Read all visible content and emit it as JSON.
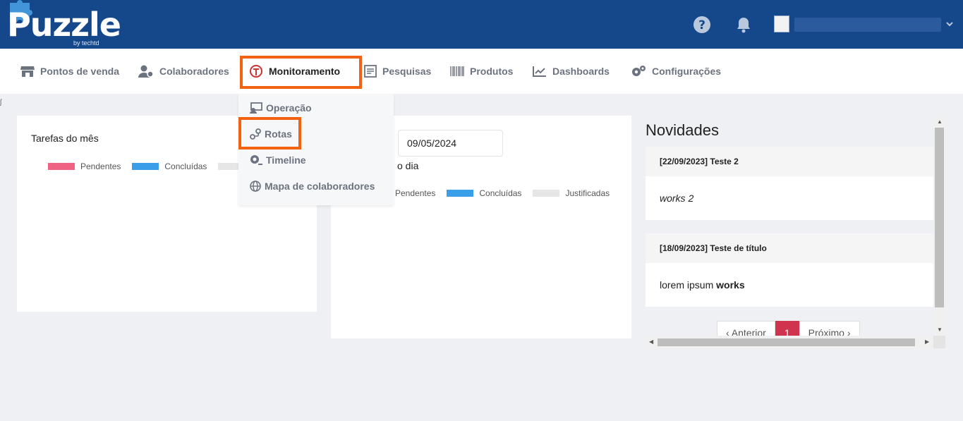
{
  "header": {
    "logo_text": "Puzzle",
    "logo_sub": "by techtd",
    "icons": [
      "help-icon",
      "bell-icon",
      "avatar",
      "chevron-down-icon"
    ],
    "brand_color": "#15478b"
  },
  "nav": {
    "items": [
      {
        "label": "Pontos de venda",
        "icon": "store-icon"
      },
      {
        "label": "Colaboradores",
        "icon": "user-gear-icon"
      },
      {
        "label": "Monitoramento",
        "icon": "route-sign-icon"
      },
      {
        "label": "Pesquisas",
        "icon": "survey-icon"
      },
      {
        "label": "Produtos",
        "icon": "barcode-icon"
      },
      {
        "label": "Dashboards",
        "icon": "chart-line-icon"
      },
      {
        "label": "Configurações",
        "icon": "gears-icon"
      }
    ],
    "active": "Monitoramento",
    "highlight_color": "#f26210"
  },
  "dropdown": {
    "items": [
      {
        "label": "Operação",
        "icon": "operation-icon"
      },
      {
        "label": "Rotas",
        "icon": "route-icon"
      },
      {
        "label": "Timeline",
        "icon": "timeline-icon"
      },
      {
        "label": "Mapa de colaboradores",
        "icon": "globe-icon"
      }
    ]
  },
  "cards": {
    "month": {
      "title": "Tarefas do mês",
      "legend": [
        {
          "label": "Pendentes",
          "color": "#f06283"
        },
        {
          "label": "Concluídas",
          "color": "#3a9ee8"
        },
        {
          "label": "",
          "color": "#e6e6e6"
        }
      ]
    },
    "day": {
      "title": "o dia",
      "date_value": "09/05/2024",
      "legend": [
        {
          "label": "Pendentes",
          "color": "#f06283"
        },
        {
          "label": "Concluídas",
          "color": "#3a9ee8"
        },
        {
          "label": "Justificadas",
          "color": "#e6e6e6"
        }
      ]
    }
  },
  "news": {
    "title": "Novidades",
    "items": [
      {
        "head": "[22/09/2023] Teste 2",
        "body": "works 2"
      },
      {
        "head": "[18/09/2023] Teste de título",
        "body_pre": "lorem ipsum ",
        "body_bold": "works"
      }
    ],
    "pager": {
      "prev": "‹ Anterior",
      "page": "1",
      "next": "Próximo ›"
    }
  }
}
